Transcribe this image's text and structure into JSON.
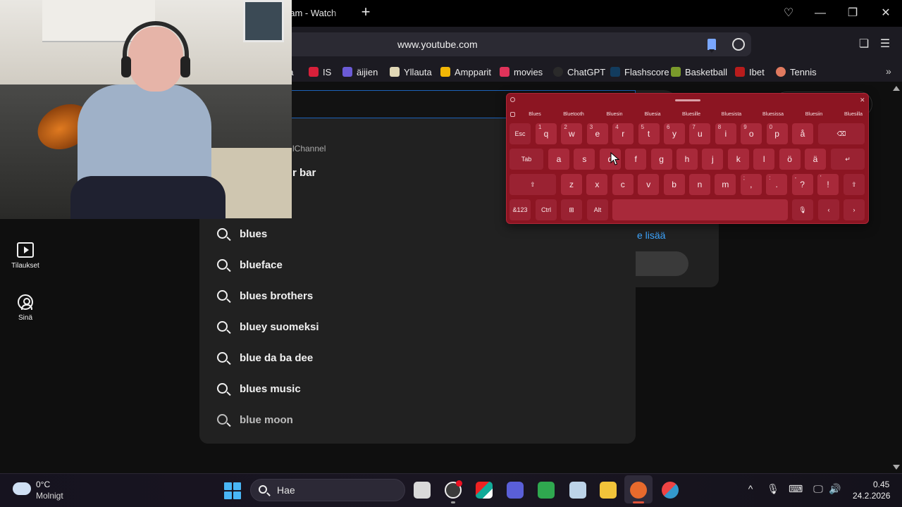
{
  "browser": {
    "tab_title": "eam - Watch",
    "new_tab_label": "+",
    "url": "www.youtube.com",
    "window_controls": {
      "minimize": "—",
      "restore": "❐",
      "close": "✕"
    },
    "bookmarks": [
      {
        "label": "na",
        "icon": "partial-icon",
        "color": "#1c1b22"
      },
      {
        "label": "IS",
        "icon": "is-logo-icon",
        "color": "#d8203a"
      },
      {
        "label": "äijien",
        "icon": "character-icon",
        "color": "#6b5bd6"
      },
      {
        "label": "Yllauta",
        "icon": "board-icon",
        "color": "#e0d7b5"
      },
      {
        "label": "Ampparit",
        "icon": "hexagon-icon",
        "color": "#f2b705"
      },
      {
        "label": "movies",
        "icon": "heart-icon",
        "color": "#e0335a"
      },
      {
        "label": "ChatGPT",
        "icon": "chatgpt-icon",
        "color": "#2a2a2a"
      },
      {
        "label": "Flashscore",
        "icon": "flashscore-icon",
        "color": "#123c5e"
      },
      {
        "label": "Basketball",
        "icon": "basketball-icon",
        "color": "#7a9a2b"
      },
      {
        "label": "Ibet",
        "icon": "ibet-icon",
        "color": "#b81c1c"
      },
      {
        "label": "Tennis",
        "icon": "tennis-icon",
        "color": "#e07a5f"
      }
    ]
  },
  "youtube": {
    "dropdown_channel": "lChannel",
    "dropdown_bar": "r bar",
    "suggestions": [
      "blues",
      "blueface",
      "blues brothers",
      "bluey suomeksi",
      "blue da ba dee",
      "blues music",
      "blue moon"
    ],
    "side_link": "e lisää",
    "nav": [
      {
        "label": "Tilaukset",
        "icon": "subscriptions-icon"
      },
      {
        "label": "Sinä",
        "icon": "you-icon"
      }
    ]
  },
  "keyboard": {
    "predictions": [
      "Blues",
      "Bluetooth",
      "Bluesin",
      "Bluesia",
      "Bluesille",
      "Bluesista",
      "Bluesissa",
      "Bluesiin",
      "Bluesilla"
    ],
    "row1": [
      {
        "k": "Esc",
        "s": ""
      },
      {
        "k": "q",
        "s": "1"
      },
      {
        "k": "w",
        "s": "2"
      },
      {
        "k": "e",
        "s": "3"
      },
      {
        "k": "r",
        "s": "4"
      },
      {
        "k": "t",
        "s": "5"
      },
      {
        "k": "y",
        "s": "6"
      },
      {
        "k": "u",
        "s": "7"
      },
      {
        "k": "i",
        "s": "8"
      },
      {
        "k": "o",
        "s": "9"
      },
      {
        "k": "p",
        "s": "0"
      },
      {
        "k": "å",
        "s": ""
      },
      {
        "k": "⌫",
        "s": ""
      }
    ],
    "row2": [
      {
        "k": "Tab",
        "s": ""
      },
      {
        "k": "a",
        "s": ""
      },
      {
        "k": "s",
        "s": ""
      },
      {
        "k": "d",
        "s": ""
      },
      {
        "k": "f",
        "s": ""
      },
      {
        "k": "g",
        "s": ""
      },
      {
        "k": "h",
        "s": ""
      },
      {
        "k": "j",
        "s": ""
      },
      {
        "k": "k",
        "s": ""
      },
      {
        "k": "l",
        "s": ""
      },
      {
        "k": "ö",
        "s": ""
      },
      {
        "k": "ä",
        "s": ""
      },
      {
        "k": "↵",
        "s": ""
      }
    ],
    "row3": [
      {
        "k": "⇧",
        "s": ""
      },
      {
        "k": "z",
        "s": ""
      },
      {
        "k": "x",
        "s": ""
      },
      {
        "k": "c",
        "s": ""
      },
      {
        "k": "v",
        "s": ""
      },
      {
        "k": "b",
        "s": ""
      },
      {
        "k": "n",
        "s": ""
      },
      {
        "k": "m",
        "s": ""
      },
      {
        "k": ",",
        "s": ";"
      },
      {
        "k": ".",
        "s": ":"
      },
      {
        "k": "?",
        "s": "-"
      },
      {
        "k": "!",
        "s": "'"
      },
      {
        "k": "⇧",
        "s": ""
      }
    ],
    "row4": [
      {
        "k": "&123",
        "s": ""
      },
      {
        "k": "Ctrl",
        "s": ""
      },
      {
        "k": "⊞",
        "s": ""
      },
      {
        "k": "Alt",
        "s": ""
      },
      {
        "k": "",
        "s": ""
      },
      {
        "k": "🎙",
        "s": ""
      },
      {
        "k": "‹",
        "s": ""
      },
      {
        "k": "›",
        "s": ""
      }
    ]
  },
  "taskbar": {
    "weather_temp": "0°C",
    "weather_desc": "Molnigt",
    "search_placeholder": "Hae",
    "time": "0.45",
    "date": "24.2.2026",
    "tray": [
      "^",
      "🎙",
      "⌨",
      "🖵",
      "🔊"
    ]
  }
}
